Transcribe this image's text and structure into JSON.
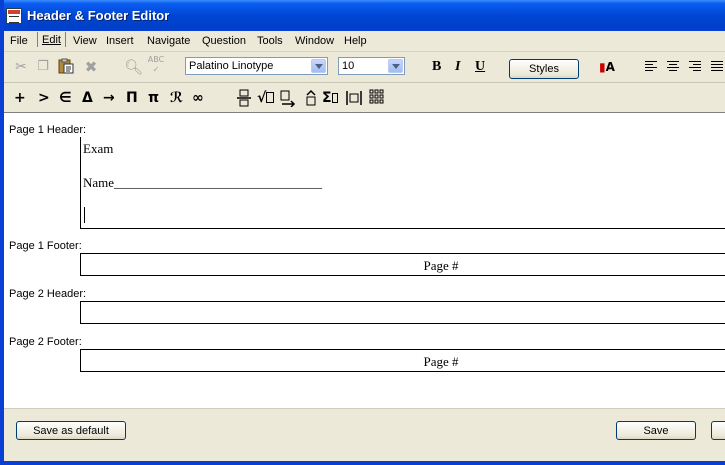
{
  "window": {
    "title": "Header & Footer Editor"
  },
  "menu": [
    "File",
    "Edit",
    "View",
    "Insert",
    "Navigate",
    "Question",
    "Tools",
    "Window",
    "Help"
  ],
  "toolbar": {
    "font_name": "Palatino Linotype",
    "font_size": "10",
    "styles_label": "Styles",
    "bold_label": "B",
    "italic_label": "I",
    "underline_label": "U",
    "spell_label": "ABC",
    "color_label": "A"
  },
  "symbols": [
    "+",
    ">",
    "∈",
    "Δ",
    "→",
    "Π",
    "π",
    "ℛ",
    "∞",
    "√",
    "Σ"
  ],
  "sections": {
    "p1_header": {
      "label": "Page 1 Header:",
      "line1": "Exam",
      "line2": "Name________________________________"
    },
    "p1_footer": {
      "label": "Page 1 Footer:",
      "text": "Page #"
    },
    "p2_header": {
      "label": "Page 2 Header:",
      "text": ""
    },
    "p2_footer": {
      "label": "Page 2 Footer:",
      "text": "Page #"
    }
  },
  "footer": {
    "save_default_label": "Save as default",
    "save_label": "Save"
  }
}
